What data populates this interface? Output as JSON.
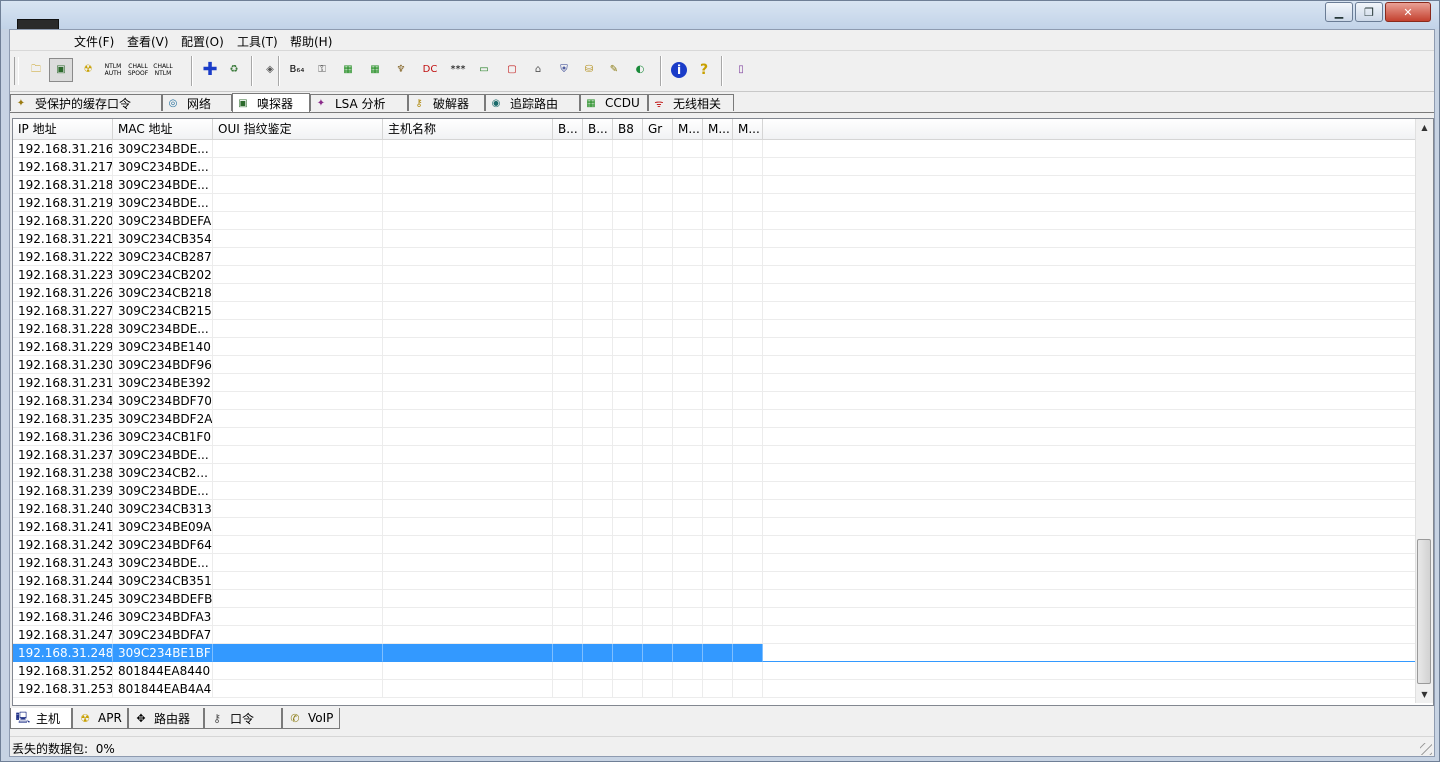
{
  "menu": [
    "文件(F)",
    "查看(V)",
    "配置(O)",
    "工具(T)",
    "帮助(H)"
  ],
  "toolbar": [
    {
      "icon": "folder-icon",
      "glyph": "🗀",
      "color": "#c8a020"
    },
    {
      "icon": "sniffer-network-card-icon",
      "glyph": "▣",
      "color": "#2c6a2c",
      "pressed": true
    },
    {
      "icon": "radiation-apr-icon",
      "glyph": "☢",
      "color": "#c8a000"
    },
    {
      "icon": "ntlm-auth-icon",
      "glyph": "NTLM AUTH",
      "color": "#000"
    },
    {
      "icon": "chall-spoof-reset-icon",
      "glyph": "CHALL SPOOF",
      "color": "#000"
    },
    {
      "icon": "chall-spoof-ntlm-icon",
      "glyph": "CHALL NTLM",
      "color": "#000"
    },
    {
      "icon": "add-plus-icon",
      "glyph": "✚",
      "color": "#1a3cc8"
    },
    {
      "icon": "shield-recycle-icon",
      "glyph": "♻",
      "color": "#3a7a3a"
    },
    {
      "icon": "cd-export-icon",
      "glyph": "◈",
      "color": "#555"
    },
    {
      "icon": "base64-icon",
      "glyph": "B₆₄",
      "color": "#000"
    },
    {
      "icon": "key-decoder-icon",
      "glyph": "⚿",
      "color": "#555"
    },
    {
      "icon": "hash-calc-icon",
      "glyph": "▦",
      "color": "#1a8a1a"
    },
    {
      "icon": "mac-calc-icon",
      "glyph": "▦",
      "color": "#1a8a1a"
    },
    {
      "icon": "wireless-key-icon",
      "glyph": "♆",
      "color": "#806020"
    },
    {
      "icon": "dc-icon",
      "glyph": "DC",
      "color": "#c01010"
    },
    {
      "icon": "password-stars-icon",
      "glyph": "***",
      "color": "#000"
    },
    {
      "icon": "terminal-icon",
      "glyph": "▭",
      "color": "#1a7a1a"
    },
    {
      "icon": "router-red-icon",
      "glyph": "▢",
      "color": "#c01010"
    },
    {
      "icon": "house-cert-icon",
      "glyph": "⌂",
      "color": "#555"
    },
    {
      "icon": "shield-globe-icon",
      "glyph": "⛨",
      "color": "#223388"
    },
    {
      "icon": "database-icon",
      "glyph": "⛁",
      "color": "#b08a10"
    },
    {
      "icon": "key-book-icon",
      "glyph": "✎",
      "color": "#8a7a10"
    },
    {
      "icon": "wifi-scan-icon",
      "glyph": "◐",
      "color": "#1a8a3a"
    },
    {
      "icon": "info-icon",
      "glyph": "i",
      "color": "#1a3cc8"
    },
    {
      "icon": "help-icon",
      "glyph": "?",
      "color": "#c8a000"
    },
    {
      "icon": "exit-door-icon",
      "glyph": "▯",
      "color": "#7a3a9a"
    }
  ],
  "top_tabs": [
    {
      "label": "受保护的缓存口令",
      "icon": "cached-password-icon",
      "glyph": "✦",
      "color": "#9a7a10"
    },
    {
      "label": "网络",
      "icon": "network-globe-icon",
      "glyph": "◎",
      "color": "#1a6a9a"
    },
    {
      "label": "嗅探器",
      "icon": "sniffer-icon",
      "glyph": "▣",
      "color": "#2c6a2c",
      "active": true
    },
    {
      "label": "LSA 分析",
      "icon": "lsa-icon",
      "glyph": "✦",
      "color": "#8a2a8a"
    },
    {
      "label": "破解器",
      "icon": "cracker-key-icon",
      "glyph": "⚷",
      "color": "#b08a10"
    },
    {
      "label": "追踪路由",
      "icon": "traceroute-icon",
      "glyph": "◉",
      "color": "#1a6a6a"
    },
    {
      "label": "CCDU",
      "icon": "ccdu-icon",
      "glyph": "▦",
      "color": "#1a8a1a"
    },
    {
      "label": "无线相关",
      "icon": "wireless-antenna-icon",
      "glyph": "ᯤ",
      "color": "#c01010"
    }
  ],
  "columns": [
    "IP 地址",
    "MAC 地址",
    "OUI 指纹鉴定",
    "主机名称",
    "B...",
    "B...",
    "B8",
    "Gr",
    "M...",
    "M...",
    "M..."
  ],
  "rows": [
    [
      "192.168.31.216",
      "309C234BDE..."
    ],
    [
      "192.168.31.217",
      "309C234BDE..."
    ],
    [
      "192.168.31.218",
      "309C234BDE..."
    ],
    [
      "192.168.31.219",
      "309C234BDE..."
    ],
    [
      "192.168.31.220",
      "309C234BDEFA"
    ],
    [
      "192.168.31.221",
      "309C234CB354"
    ],
    [
      "192.168.31.222",
      "309C234CB287"
    ],
    [
      "192.168.31.223",
      "309C234CB202"
    ],
    [
      "192.168.31.226",
      "309C234CB218"
    ],
    [
      "192.168.31.227",
      "309C234CB215"
    ],
    [
      "192.168.31.228",
      "309C234BDE..."
    ],
    [
      "192.168.31.229",
      "309C234BE140"
    ],
    [
      "192.168.31.230",
      "309C234BDF96"
    ],
    [
      "192.168.31.231",
      "309C234BE392"
    ],
    [
      "192.168.31.234",
      "309C234BDF70"
    ],
    [
      "192.168.31.235",
      "309C234BDF2A"
    ],
    [
      "192.168.31.236",
      "309C234CB1F0"
    ],
    [
      "192.168.31.237",
      "309C234BDE..."
    ],
    [
      "192.168.31.238",
      "309C234CB2..."
    ],
    [
      "192.168.31.239",
      "309C234BDE..."
    ],
    [
      "192.168.31.240",
      "309C234CB313"
    ],
    [
      "192.168.31.241",
      "309C234BE09A"
    ],
    [
      "192.168.31.242",
      "309C234BDF64"
    ],
    [
      "192.168.31.243",
      "309C234BDE..."
    ],
    [
      "192.168.31.244",
      "309C234CB351"
    ],
    [
      "192.168.31.245",
      "309C234BDEFB"
    ],
    [
      "192.168.31.246",
      "309C234BDFA3"
    ],
    [
      "192.168.31.247",
      "309C234BDFA7"
    ],
    [
      "192.168.31.248",
      "309C234BE1BF"
    ],
    [
      "192.168.31.252",
      "801844EA8440"
    ],
    [
      "192.168.31.253",
      "801844EAB4A4"
    ]
  ],
  "selected_row": 28,
  "selection_color": "#3399ff",
  "bottom_tabs": [
    {
      "label": "主机",
      "icon": "host-computer-icon",
      "glyph": "🖳",
      "color": "#223388",
      "active": true
    },
    {
      "label": "APR",
      "icon": "apr-radiation-icon",
      "glyph": "☢",
      "color": "#c8a000"
    },
    {
      "label": "路由器",
      "icon": "router-arrows-icon",
      "glyph": "✥",
      "color": "#000"
    },
    {
      "label": "口令",
      "icon": "password-key-icon",
      "glyph": "⚷",
      "color": "#555"
    },
    {
      "label": "VoIP",
      "icon": "voip-icon",
      "glyph": "✆",
      "color": "#8a7a10"
    }
  ],
  "status": {
    "lost_packets_label": "丢失的数据包:",
    "lost_packets_value": "0%"
  }
}
